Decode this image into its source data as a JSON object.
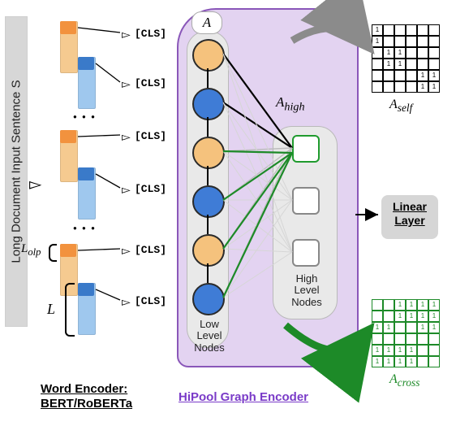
{
  "chart_data": {
    "type": "diagram",
    "title": "HiPool architecture diagram",
    "components": {
      "input": "Long Document Input Sentence S",
      "word_encoder": "BERT/RoBERTa",
      "graph_encoder": "HiPool Graph Encoder",
      "output": "Linear Layer",
      "low_level_nodes": 6,
      "high_level_nodes": 3,
      "adjacency_A": "A",
      "adjacency_high": "A_high",
      "matrices": {
        "A_self": {
          "rows": 6,
          "cols": 6,
          "pattern": "block-diagonal pairs"
        },
        "A_cross": {
          "rows": 6,
          "cols": 6,
          "pattern": "off-block complement of A_self"
        }
      },
      "chunking": {
        "num_chunks": 6,
        "chunk_length_symbol": "L",
        "overlap_symbol": "L_olp",
        "token_per_chunk": "[CLS]"
      }
    }
  },
  "input_label": "Long Document Input Sentence S",
  "cls": "[CLS]",
  "A_label": "A",
  "Ahigh_label": "A",
  "Ahigh_sub": "high",
  "low_caption_l1": "Low",
  "low_caption_l2": "Level",
  "low_caption_l3": "Nodes",
  "high_caption_l1": "High",
  "high_caption_l2": "Level",
  "high_caption_l3": "Nodes",
  "linear_l1": "Linear",
  "linear_l2": "Layer",
  "Aself_label": "A",
  "Aself_sub": "self",
  "Across_label": "A",
  "Across_sub": "cross",
  "L_label": "L",
  "Lolp_label": "L",
  "Lolp_sub": "olp",
  "word_encoder_l1": "Word Encoder:",
  "word_encoder_l2": "BERT/RoBERTa",
  "graph_encoder_label": "HiPool  Graph Encoder",
  "A_self_matrix": [
    [
      1,
      0,
      0,
      0,
      0,
      0
    ],
    [
      1,
      0,
      0,
      0,
      0,
      0
    ],
    [
      0,
      1,
      1,
      0,
      0,
      0
    ],
    [
      0,
      1,
      1,
      0,
      0,
      0
    ],
    [
      0,
      0,
      0,
      0,
      1,
      1
    ],
    [
      0,
      0,
      0,
      0,
      1,
      1
    ]
  ],
  "A_cross_matrix": [
    [
      0,
      0,
      1,
      1,
      1,
      1
    ],
    [
      0,
      0,
      1,
      1,
      1,
      1
    ],
    [
      1,
      1,
      0,
      0,
      1,
      1
    ],
    [
      0,
      0,
      0,
      0,
      0,
      0
    ],
    [
      1,
      1,
      1,
      1,
      0,
      0
    ],
    [
      1,
      1,
      1,
      1,
      0,
      0
    ]
  ]
}
